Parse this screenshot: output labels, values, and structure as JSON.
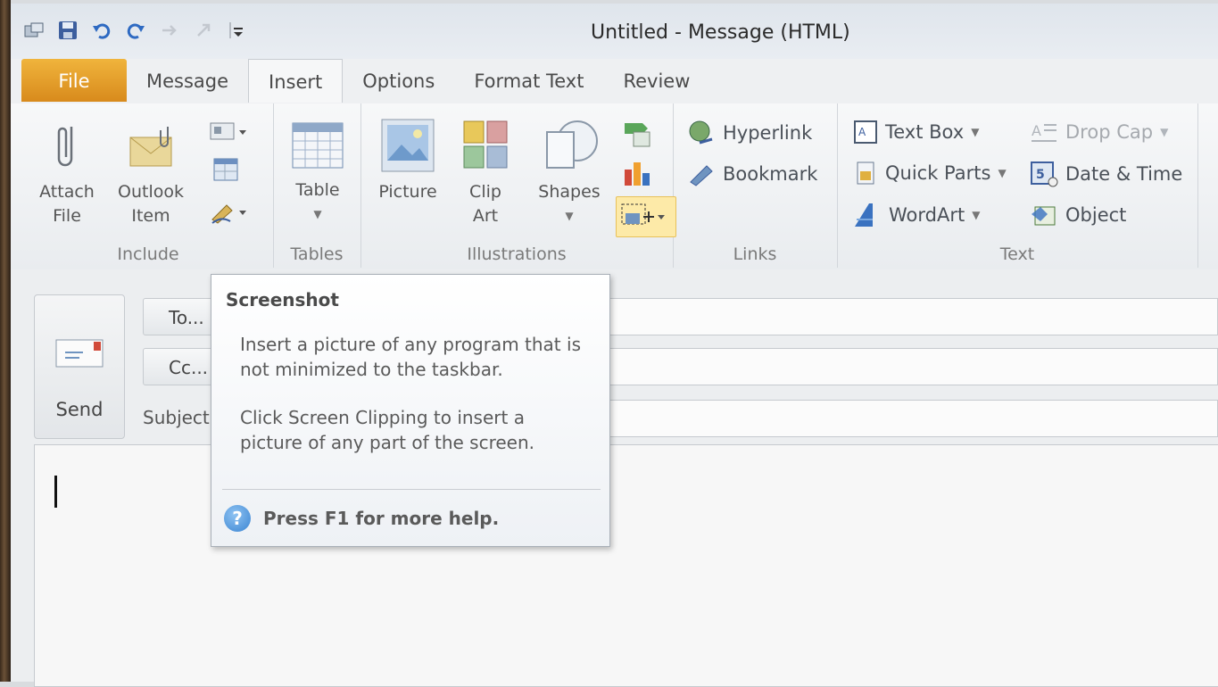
{
  "window": {
    "title": "Untitled - Message (HTML)"
  },
  "quick_access": [
    "window-icon",
    "save-icon",
    "undo-icon",
    "redo-icon",
    "forward-icon",
    "back-icon",
    "customize-icon"
  ],
  "tabs": [
    {
      "label": "File"
    },
    {
      "label": "Message"
    },
    {
      "label": "Insert"
    },
    {
      "label": "Options"
    },
    {
      "label": "Format Text"
    },
    {
      "label": "Review"
    }
  ],
  "ribbon": {
    "include": {
      "label": "Include",
      "attach_l1": "Attach",
      "attach_l2": "File",
      "outlook_l1": "Outlook",
      "outlook_l2": "Item"
    },
    "tables": {
      "label": "Tables",
      "table": "Table"
    },
    "illustrations": {
      "label": "Illustrations",
      "picture": "Picture",
      "clip_l1": "Clip",
      "clip_l2": "Art",
      "shapes": "Shapes"
    },
    "links": {
      "label": "Links",
      "hyperlink": "Hyperlink",
      "bookmark": "Bookmark"
    },
    "text": {
      "label": "Text",
      "text_box": "Text Box",
      "quick_parts": "Quick Parts",
      "wordart": "WordArt",
      "drop_cap": "Drop Cap",
      "date_time": "Date & Time",
      "object": "Object"
    }
  },
  "compose": {
    "send": "Send",
    "to": "To...",
    "cc": "Cc...",
    "subject": "Subject"
  },
  "tooltip": {
    "title": "Screenshot",
    "para1": "Insert a picture of any program that is not minimized to the taskbar.",
    "para2": "Click Screen Clipping to insert a picture of any part of the screen.",
    "help": "Press F1 for more help."
  },
  "colors": {
    "file_tab": "#e09a28",
    "accent_blue": "#3a84d2"
  }
}
